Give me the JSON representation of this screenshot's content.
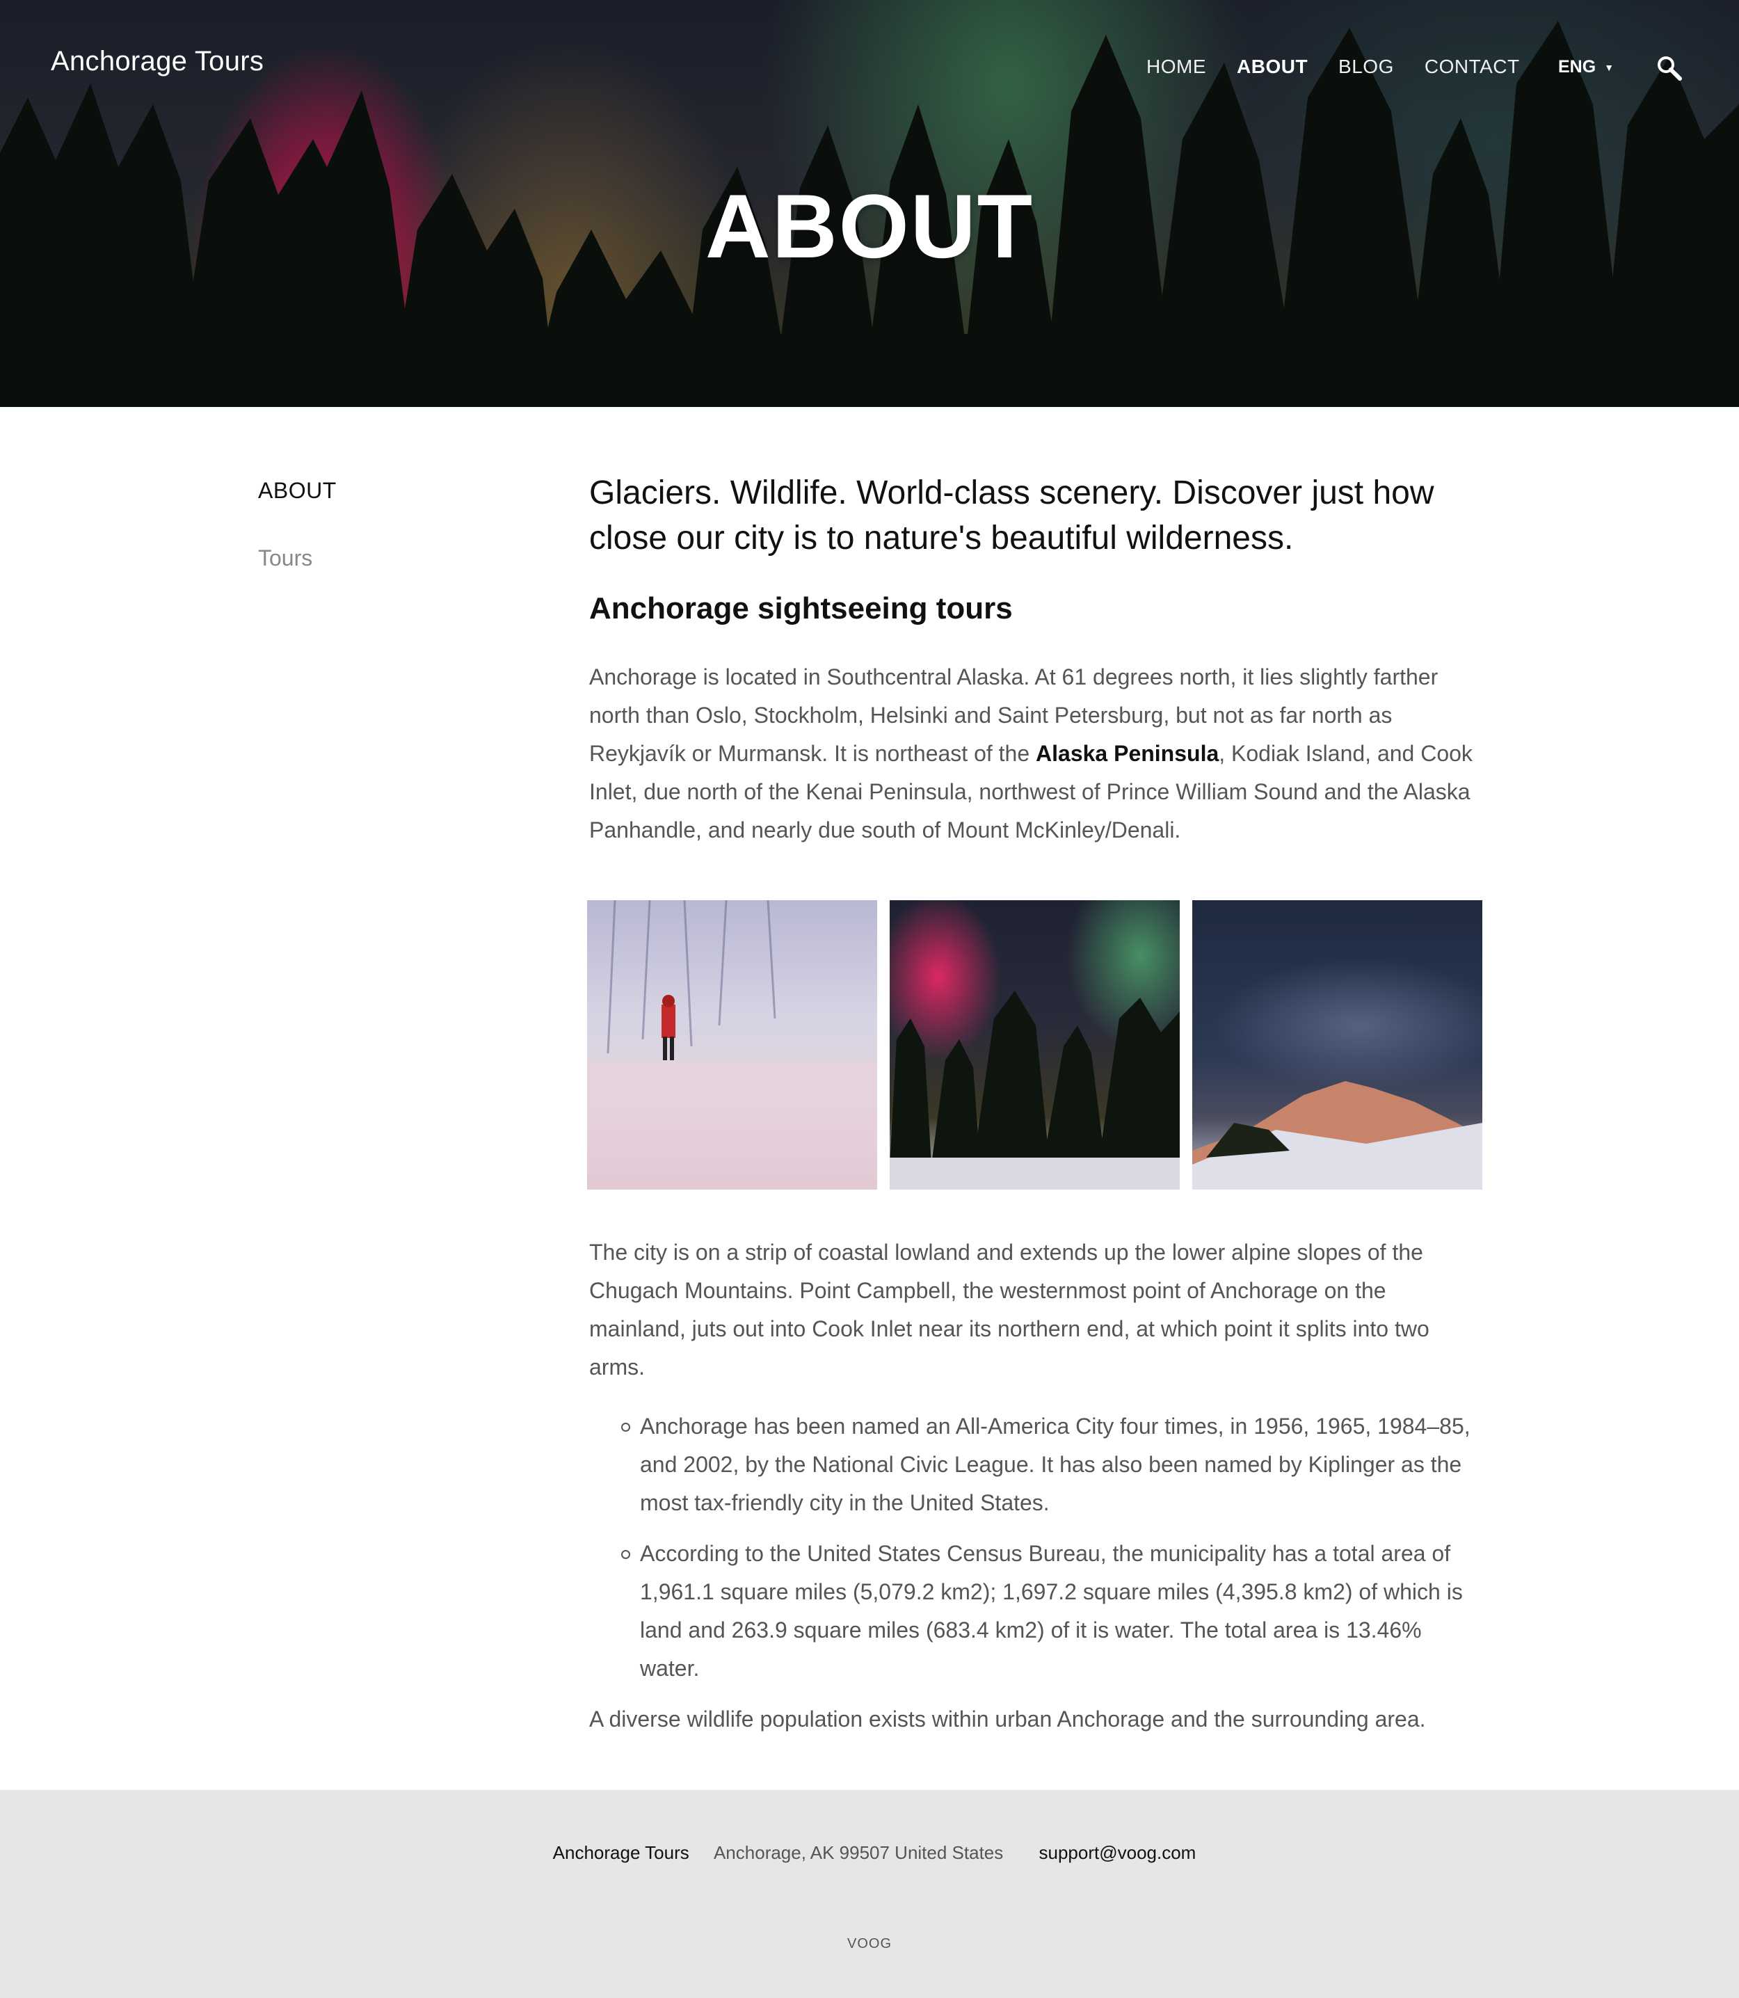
{
  "header": {
    "site_title": "Anchorage Tours",
    "nav": [
      {
        "label": "HOME",
        "active": false
      },
      {
        "label": "ABOUT",
        "active": true
      },
      {
        "label": "BLOG",
        "active": false
      },
      {
        "label": "CONTACT",
        "active": false
      }
    ],
    "language": "ENG",
    "search_icon": "search-icon"
  },
  "hero": {
    "title": "ABOUT"
  },
  "sidebar": {
    "items": [
      {
        "label": "ABOUT",
        "active": true
      },
      {
        "label": "Tours",
        "active": false
      }
    ]
  },
  "content": {
    "lead": "Glaciers. Wildlife. World-class scenery. Discover just how close our city is to nature's beautiful wilderness.",
    "heading": "Anchorage sightseeing tours",
    "para1_before": "Anchorage is located in Southcentral Alaska. At 61 degrees north, it lies slightly farther north than Oslo, Stockholm, Helsinki and Saint Petersburg, but not as far north as Reykjavík or Murmansk. It is northeast of the ",
    "para1_link": "Alaska Peninsula",
    "para1_after": ", Kodiak Island, and Cook Inlet, due north of the Kenai Peninsula, northwest of Prince William Sound and the Alaska Panhandle, and nearly due south of Mount McKinley/Denali.",
    "para2": "The city is on a strip of coastal lowland and extends up the lower alpine slopes of the Chugach Mountains. Point Campbell, the westernmost point of Anchorage on the mainland, juts out into Cook Inlet near its northern end, at which point it splits into two arms.",
    "bullets": [
      "Anchorage has been named an All-America City four times, in 1956, 1965, 1984–85, and 2002, by the National Civic League. It has also been named by Kiplinger as the most tax-friendly city in the United States.",
      "According to the United States Census Bureau, the municipality has a total area of 1,961.1 square miles (5,079.2 km2); 1,697.2 square miles (4,395.8 km2) of which is land and 263.9 square miles (683.4 km2) of it is water. The total area is 13.46% water."
    ],
    "para3": "A diverse wildlife population exists within urban Anchorage and the surrounding area."
  },
  "gallery": [
    "snowy-forest-photo",
    "northern-lights-photo",
    "starry-mountain-photo"
  ],
  "footer": {
    "name": "Anchorage Tours",
    "address": "Anchorage, AK 99507 United States",
    "email": "support@voog.com",
    "brand": "VOOG"
  }
}
